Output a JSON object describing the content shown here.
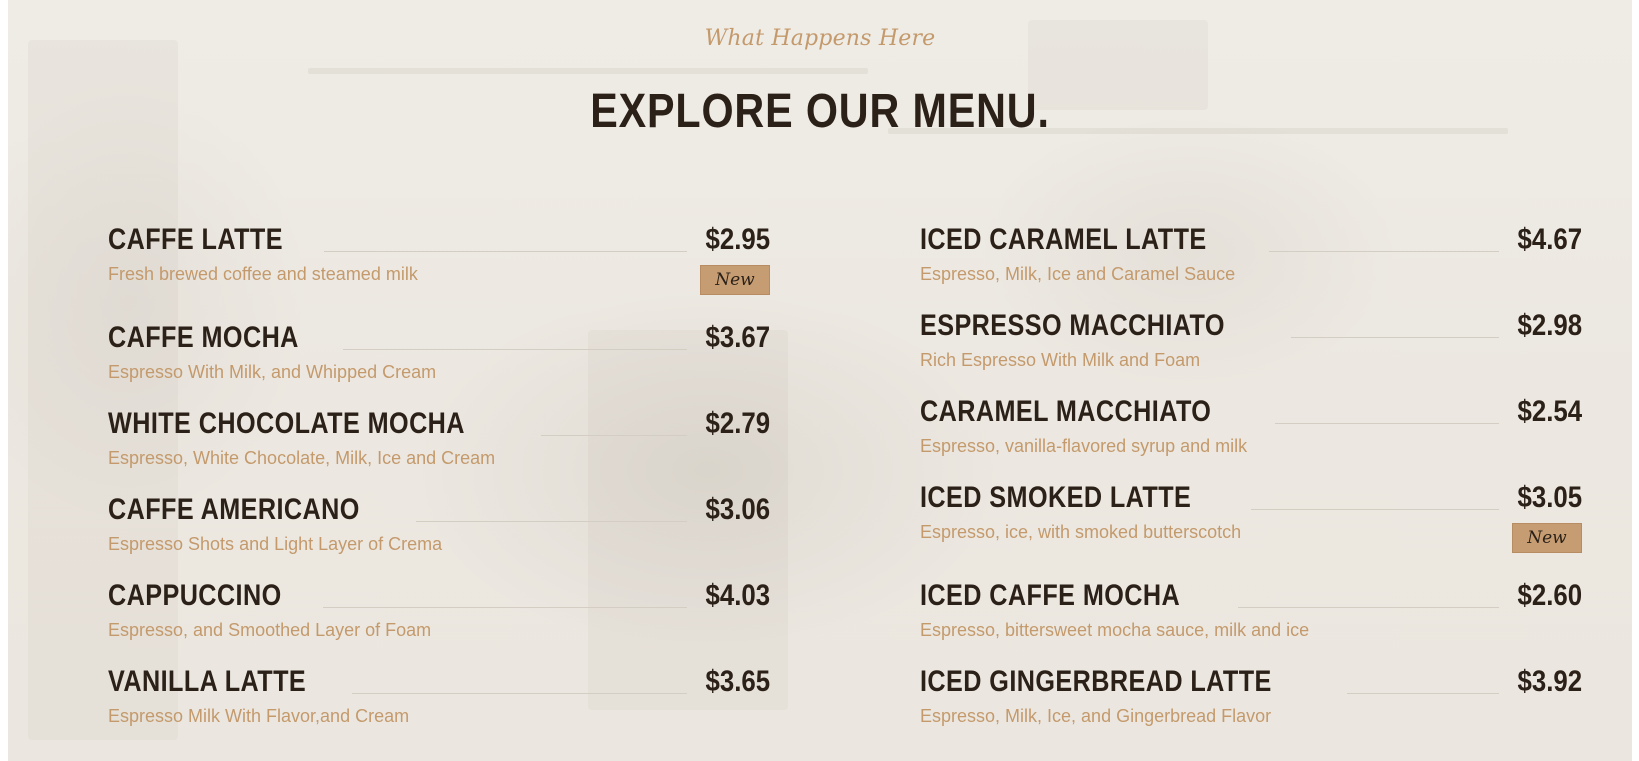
{
  "header": {
    "subtitle": "What Happens Here",
    "title": "EXPLORE OUR MENU."
  },
  "menu": {
    "left": [
      {
        "name": "CAFFE LATTE",
        "price": "$2.95",
        "description": "Fresh brewed coffee and steamed milk",
        "badge": "New"
      },
      {
        "name": "CAFFE MOCHA",
        "price": "$3.67",
        "description": "Espresso With Milk, and Whipped Cream"
      },
      {
        "name": "WHITE CHOCOLATE MOCHA",
        "price": "$2.79",
        "description": "Espresso, White Chocolate, Milk, Ice and Cream"
      },
      {
        "name": "CAFFE AMERICANO",
        "price": "$3.06",
        "description": "Espresso Shots and Light Layer of Crema"
      },
      {
        "name": "CAPPUCCINO",
        "price": "$4.03",
        "description": "Espresso, and Smoothed Layer of Foam"
      },
      {
        "name": "VANILLA LATTE",
        "price": "$3.65",
        "description": "Espresso Milk With Flavor,and Cream"
      }
    ],
    "right": [
      {
        "name": "ICED CARAMEL LATTE",
        "price": "$4.67",
        "description": "Espresso, Milk, Ice and Caramel Sauce"
      },
      {
        "name": "ESPRESSO MACCHIATO",
        "price": "$2.98",
        "description": "Rich Espresso With Milk and Foam"
      },
      {
        "name": "CARAMEL MACCHIATO",
        "price": "$2.54",
        "description": "Espresso, vanilla-flavored syrup and milk"
      },
      {
        "name": "ICED SMOKED LATTE",
        "price": "$3.05",
        "description": "Espresso, ice, with smoked butterscotch",
        "badge": "New"
      },
      {
        "name": "ICED CAFFE MOCHA",
        "price": "$2.60",
        "description": "Espresso, bittersweet mocha sauce, milk and ice"
      },
      {
        "name": "ICED GINGERBREAD LATTE",
        "price": "$3.92",
        "description": "Espresso, Milk, Ice, and Gingerbread Flavor"
      }
    ]
  },
  "colors": {
    "accent": "#c49a6c",
    "heading": "#2b2118",
    "badge_bg": "#c69c72"
  }
}
